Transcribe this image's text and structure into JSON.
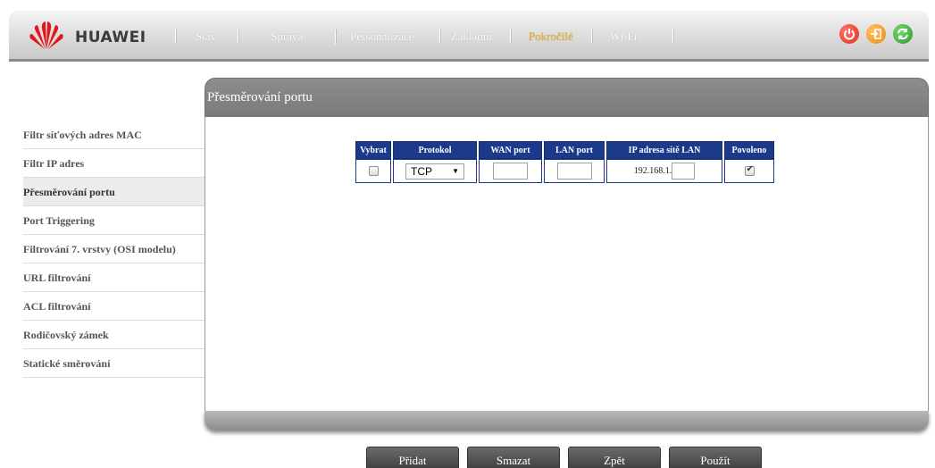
{
  "header": {
    "brand": "HUAWEI",
    "nav": [
      {
        "label": "Stav",
        "active": false
      },
      {
        "label": "Správa",
        "active": false
      },
      {
        "label": "Personalizace",
        "active": false
      },
      {
        "label": "Základní",
        "active": false
      },
      {
        "label": "Pokročilé",
        "active": true
      },
      {
        "label": "Wi-Fi",
        "active": false
      }
    ],
    "icons": [
      "power-icon",
      "logout-icon",
      "refresh-icon"
    ]
  },
  "sidebar": {
    "items": [
      {
        "label": "Filtr síťových adres MAC"
      },
      {
        "label": "Filtr IP adres"
      },
      {
        "label": "Přesměrování portu"
      },
      {
        "label": "Port Triggering"
      },
      {
        "label": "Filtrování 7. vrstvy (OSI modelu)"
      },
      {
        "label": "URL filtrování"
      },
      {
        "label": "ACL filtrování"
      },
      {
        "label": "Rodičovský zámek"
      },
      {
        "label": "Statické směrování"
      }
    ],
    "active_index": 2
  },
  "panel": {
    "title": "Přesměrování portu"
  },
  "table": {
    "headers": [
      "Vybrat",
      "Protokol",
      "WAN port",
      "LAN port",
      "IP adresa sítě LAN",
      "Povoleno"
    ],
    "row": {
      "select_checked": false,
      "protocol": "TCP",
      "wan_port": "",
      "lan_port": "",
      "ip_prefix": "192.168.1.",
      "ip_last_octet": "",
      "enabled": true
    }
  },
  "buttons": {
    "add": "Přidat",
    "delete": "Smazat",
    "back": "Zpět",
    "apply": "Použít"
  },
  "colors": {
    "accent_active_nav": "#f0b023",
    "table_header": "#1b3a8c",
    "panel_header": "#7d7d7d"
  }
}
